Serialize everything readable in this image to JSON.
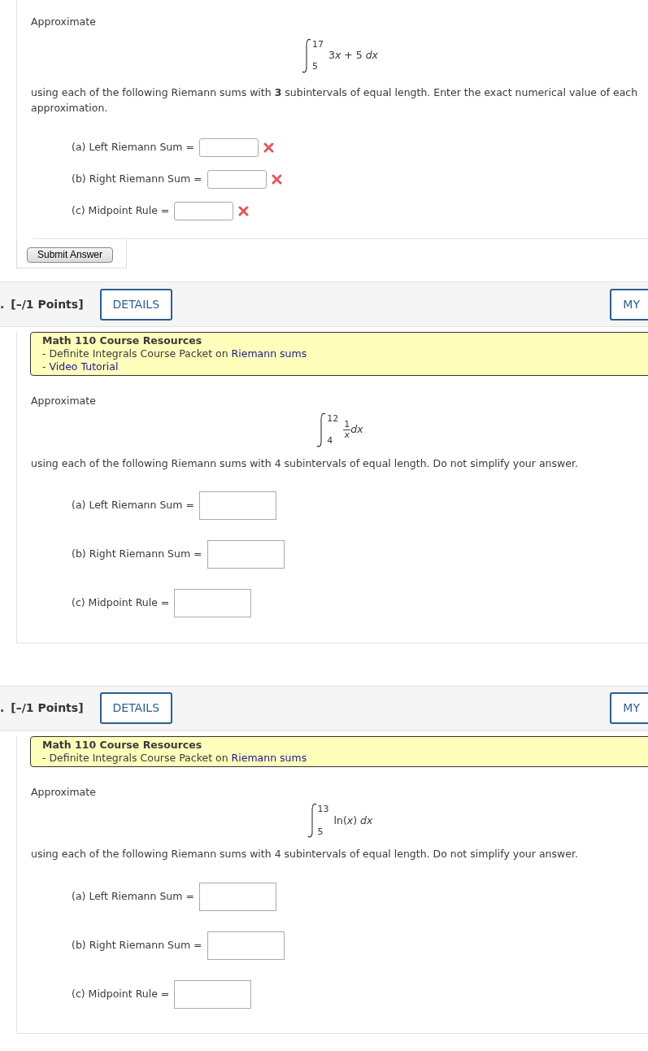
{
  "questions": [
    {
      "kind": "graded",
      "prompt": "Approximate",
      "integral": {
        "lower": "5",
        "upper": "17",
        "integrand": [
          {
            "kind": "text",
            "text": "3"
          },
          {
            "kind": "var",
            "text": "x"
          },
          {
            "kind": "text",
            "text": " + 5 "
          },
          {
            "kind": "var",
            "text": "dx"
          }
        ]
      },
      "instruction": "using each of the following Riemann sums with **3** subintervals of equal length. Enter the exact numerical value of each approximation.",
      "parts": [
        {
          "label": "(a) Left Riemann Sum",
          "sign": "=",
          "incorrect": true
        },
        {
          "label": "(b) Right Riemann Sum",
          "sign": "=",
          "incorrect": true
        },
        {
          "label": "(c) Midpoint Rule",
          "sign": "=",
          "incorrect": true
        }
      ],
      "submit": "Submit Answer"
    },
    {
      "kind": "open",
      "header": {
        "number_tail": ".",
        "points": "[–/1 Points]",
        "details": "DETAILS",
        "right_button": "MY"
      },
      "resources": {
        "title": "Math 110 Course Resources",
        "lines": [
          {
            "prefix": "- Definite Integrals Course Packet on",
            "link": "Riemann sums"
          },
          {
            "prefix": "-",
            "link": "Video Tutorial"
          }
        ]
      },
      "prompt": "Approximate",
      "integral": {
        "lower": "4",
        "upper": "12",
        "integrand": [
          {
            "kind": "fraction",
            "numerator": "1",
            "denominator": "*x*"
          },
          {
            "kind": "var",
            "text": "dx"
          }
        ]
      },
      "instruction": "using each of the following Riemann sums with 4 subintervals of equal length. Do not simplify your answer.",
      "parts": [
        {
          "label": "(a) Left Riemann Sum",
          "sign": "=",
          "incorrect": false
        },
        {
          "label": "(b) Right Riemann Sum",
          "sign": "=",
          "incorrect": false
        },
        {
          "label": "(c) Midpoint Rule",
          "sign": "=",
          "incorrect": false
        }
      ]
    },
    {
      "kind": "open",
      "header": {
        "number_tail": ".",
        "points": "[–/1 Points]",
        "details": "DETAILS",
        "right_button": "MY"
      },
      "resources": {
        "title": "Math 110 Course Resources",
        "lines": [
          {
            "prefix": "- Definite Integrals Course Packet on",
            "link": "Riemann sums"
          }
        ]
      },
      "prompt": "Approximate",
      "integral": {
        "lower": "5",
        "upper": "13",
        "integrand": [
          {
            "kind": "text",
            "text": "ln("
          },
          {
            "kind": "var",
            "text": "x"
          },
          {
            "kind": "text",
            "text": ") "
          },
          {
            "kind": "var",
            "text": "dx"
          }
        ]
      },
      "instruction": "using each of the following Riemann sums with 4 subintervals of equal length. Do not simplify your answer.",
      "parts": [
        {
          "label": "(a) Left Riemann Sum",
          "sign": "=",
          "incorrect": false
        },
        {
          "label": "(b) Right Riemann Sum",
          "sign": "=",
          "incorrect": false
        },
        {
          "label": "(c) Midpoint Rule",
          "sign": "=",
          "incorrect": false
        }
      ]
    }
  ]
}
